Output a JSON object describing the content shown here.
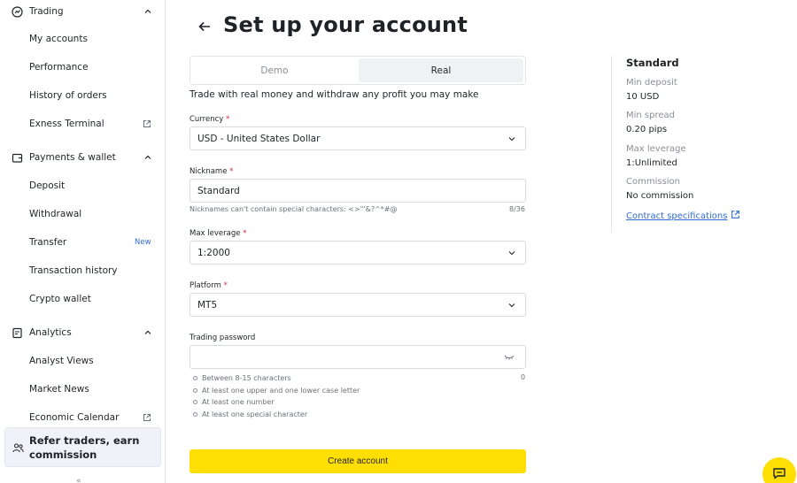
{
  "sidebar": {
    "trading": {
      "label": "Trading"
    },
    "trading_items": [
      {
        "label": "My accounts"
      },
      {
        "label": "Performance"
      },
      {
        "label": "History of orders"
      },
      {
        "label": "Exness Terminal"
      }
    ],
    "payments": {
      "label": "Payments & wallet"
    },
    "payments_items": [
      {
        "label": "Deposit"
      },
      {
        "label": "Withdrawal"
      },
      {
        "label": "Transfer",
        "badge": "New"
      },
      {
        "label": "Transaction history"
      },
      {
        "label": "Crypto wallet"
      }
    ],
    "analytics": {
      "label": "Analytics"
    },
    "analytics_items": [
      {
        "label": "Analyst Views"
      },
      {
        "label": "Market News"
      },
      {
        "label": "Economic Calendar"
      }
    ],
    "refer": {
      "label": "Refer traders, earn commission"
    },
    "more": "«"
  },
  "header": {
    "title": "Set up your account"
  },
  "tabs": {
    "demo": "Demo",
    "real": "Real",
    "description": "Trade with real money and withdraw any profit you may make"
  },
  "form": {
    "currency": {
      "label": "Currency",
      "required": "*",
      "value": "USD - United States Dollar"
    },
    "nickname": {
      "label": "Nickname",
      "required": "*",
      "value": "Standard",
      "hint": "Nicknames can't contain special characters: <>\"'&?^*#@",
      "counter": "8/36"
    },
    "leverage": {
      "label": "Max leverage",
      "required": "*",
      "value": "1:2000"
    },
    "platform": {
      "label": "Platform",
      "required": "*",
      "value": "MT5"
    },
    "password": {
      "label": "Trading password",
      "value": "",
      "counter": "0",
      "rules": [
        "Between 8-15 characters",
        "At least one upper and one lower case letter",
        "At least one number",
        "At least one special character"
      ]
    },
    "submit": "Create account"
  },
  "summary": {
    "title": "Standard",
    "rows": [
      {
        "key": "Min deposit",
        "value": "10 USD"
      },
      {
        "key": "Min spread",
        "value": "0.20 pips"
      },
      {
        "key": "Max leverage",
        "value": "1:Unlimited"
      },
      {
        "key": "Commission",
        "value": "No commission"
      }
    ],
    "link": "Contract specifications"
  },
  "colors": {
    "accent": "#ffde02",
    "link": "#2e6bd8",
    "required": "#d7263d"
  }
}
